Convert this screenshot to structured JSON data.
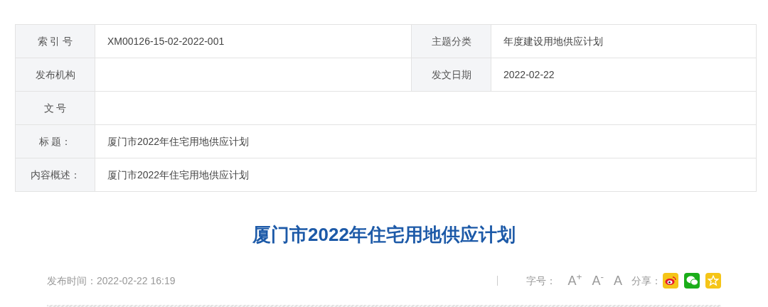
{
  "info_table": {
    "rows": [
      {
        "cells": [
          {
            "label": "索 引 号",
            "value": "XM00126-15-02-2022-001"
          },
          {
            "label": "主题分类",
            "value": "年度建设用地供应计划"
          }
        ]
      },
      {
        "cells": [
          {
            "label": "发布机构"
          },
          {
            "label": "发文日期",
            "value": "2022-02-22"
          }
        ]
      },
      {
        "cells": [
          {
            "label": "文 号"
          }
        ]
      },
      {
        "cells": [
          {
            "label": "标 题：",
            "value": "厦门市2022年住宅用地供应计划"
          }
        ]
      },
      {
        "cells": [
          {
            "label": "内容概述：",
            "value": "厦门市2022年住宅用地供应计划"
          }
        ]
      }
    ]
  },
  "article": {
    "title": "厦门市2022年住宅用地供应计划",
    "publish_time": "发布时间：2022-02-22 16:19",
    "font_size_label": "字号：",
    "font_sizes": [
      "A$^{+}$",
      "A$^{-}$",
      "A"
    ],
    "share_label": "分享：",
    "share_buttons": [
      {
        "kind": "weibo"
      },
      {
        "kind": "wechat"
      },
      {
        "kind": "favorite"
      }
    ]
  }
}
